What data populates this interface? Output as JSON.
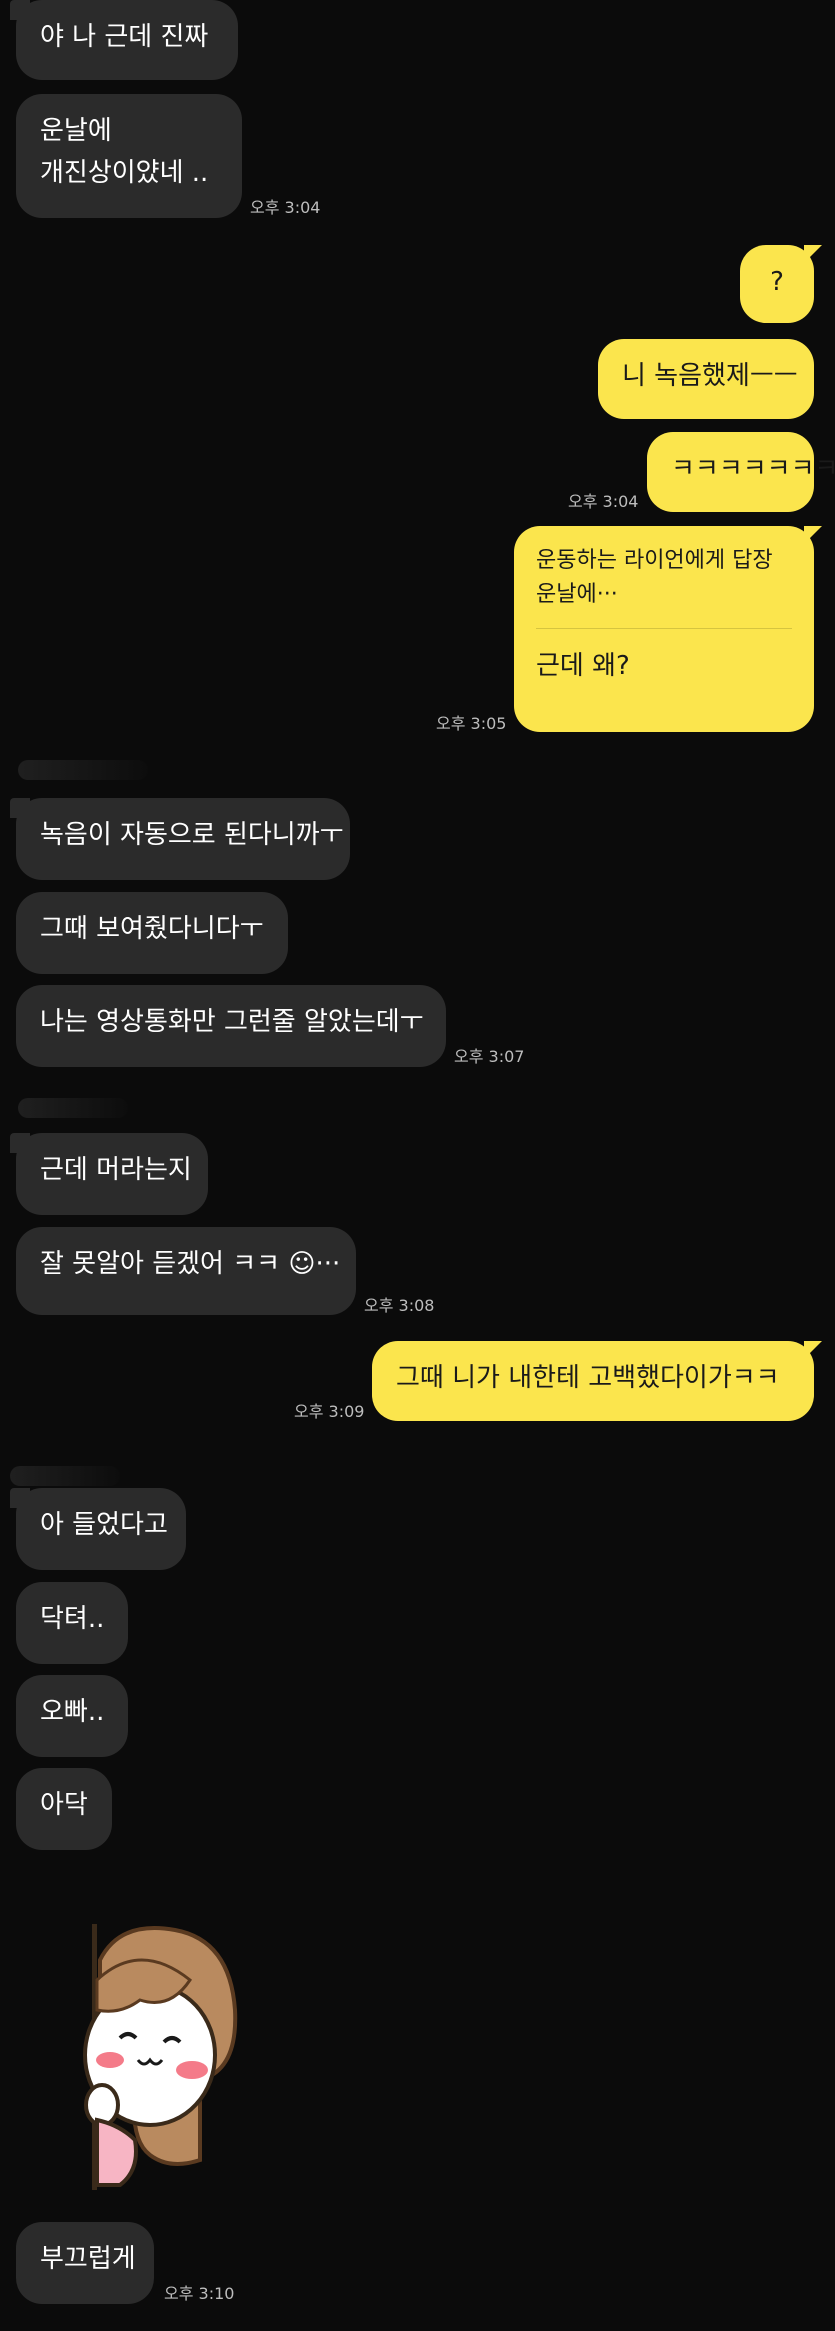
{
  "messages": {
    "m1": "야 나 근데 진짜",
    "m2a": "운날에",
    "m2b": "개진상이얐네 ..",
    "t1": "오후 3:04",
    "m3": "?",
    "m4": "니 녹음했제ㅡㅡ",
    "m5": "ㅋㅋㅋㅋㅋㅋㅋ",
    "t2": "오후 3:04",
    "reply_quote_title": "운동하는 라이언에게 답장",
    "reply_quote_text": "운날에···",
    "m6": "근데 왜?",
    "t3": "오후 3:05",
    "m7": "녹음이 자동으로 된다니까ㅜ",
    "m8": "그때 보여줬다니다ㅜ",
    "m9": "나는 영상통화만 그런줄 알았는데ㅜ",
    "t4": "오후 3:07",
    "m10": "근데 머라는지",
    "m11": "잘 못알아 듣겠어 ㅋㅋ ☺︎···",
    "t5": "오후 3:08",
    "m12": "그때 니가 내한테 고백했다이가ㅋㅋ",
    "t6": "오후 3:09",
    "m13": "아 들었다고",
    "m14": "닥텨..",
    "m15": "오빠..",
    "m16": "아닥",
    "m17": "부끄럽게",
    "t7": "오후 3:10"
  },
  "colors": {
    "background": "#0b0b0b",
    "incoming_bubble": "#2b2b2b",
    "outgoing_bubble": "#fbe54d"
  },
  "sticker": {
    "icon": "shy-girl-sticker"
  }
}
